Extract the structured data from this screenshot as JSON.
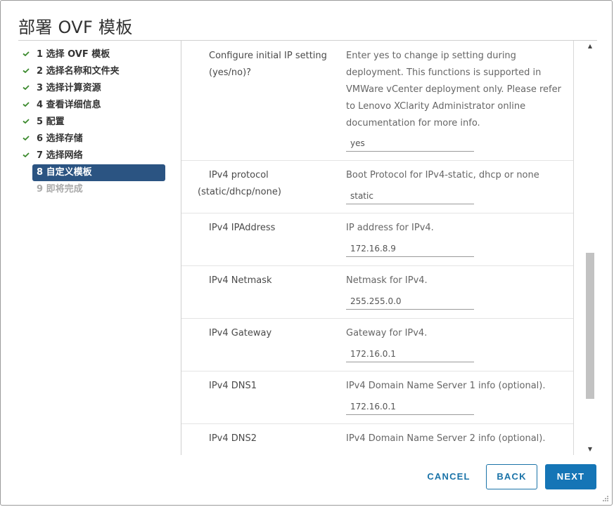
{
  "dialog": {
    "title": "部署 OVF 模板"
  },
  "steps": [
    {
      "label": "1 选择 OVF 模板",
      "state": "done"
    },
    {
      "label": "2 选择名称和文件夹",
      "state": "done"
    },
    {
      "label": "3 选择计算资源",
      "state": "done"
    },
    {
      "label": "4 查看详细信息",
      "state": "done"
    },
    {
      "label": "5 配置",
      "state": "done"
    },
    {
      "label": "6 选择存储",
      "state": "done"
    },
    {
      "label": "7 选择网络",
      "state": "done"
    },
    {
      "label": "8 自定义模板",
      "state": "active"
    },
    {
      "label": "9 即将完成",
      "state": "disabled"
    }
  ],
  "properties": [
    {
      "label": "Configure initial IP setting (yes/no)?",
      "description": "Enter yes to change ip setting during deployment. This functions is supported in VMWare vCenter deployment only. Please refer to Lenovo XClarity Administrator online documentation for more info.",
      "value": "yes"
    },
    {
      "label": "IPv4 protocol (static/dhcp/none)",
      "description": "Boot Protocol for IPv4-static, dhcp or none",
      "value": "static"
    },
    {
      "label": "IPv4 IPAddress",
      "description": "IP address for IPv4.",
      "value": "172.16.8.9"
    },
    {
      "label": "IPv4 Netmask",
      "description": "Netmask for IPv4.",
      "value": "255.255.0.0"
    },
    {
      "label": "IPv4 Gateway",
      "description": "Gateway for IPv4.",
      "value": "172.16.0.1"
    },
    {
      "label": "IPv4 DNS1",
      "description": "IPv4 Domain Name Server 1 info (optional).",
      "value": "172.16.0.1"
    },
    {
      "label": "IPv4 DNS2",
      "description": "IPv4 Domain Name Server 2 info (optional).",
      "value": ""
    }
  ],
  "footer": {
    "cancel_label": "CANCEL",
    "back_label": "BACK",
    "next_label": "NEXT"
  },
  "colors": {
    "accent": "#1575b6",
    "active_step": "#2b5482",
    "check": "#3c8a2e"
  },
  "icons": {
    "step_done": "checkmark-icon",
    "scroll_up": "arrow-up-icon",
    "scroll_down": "arrow-down-icon"
  }
}
